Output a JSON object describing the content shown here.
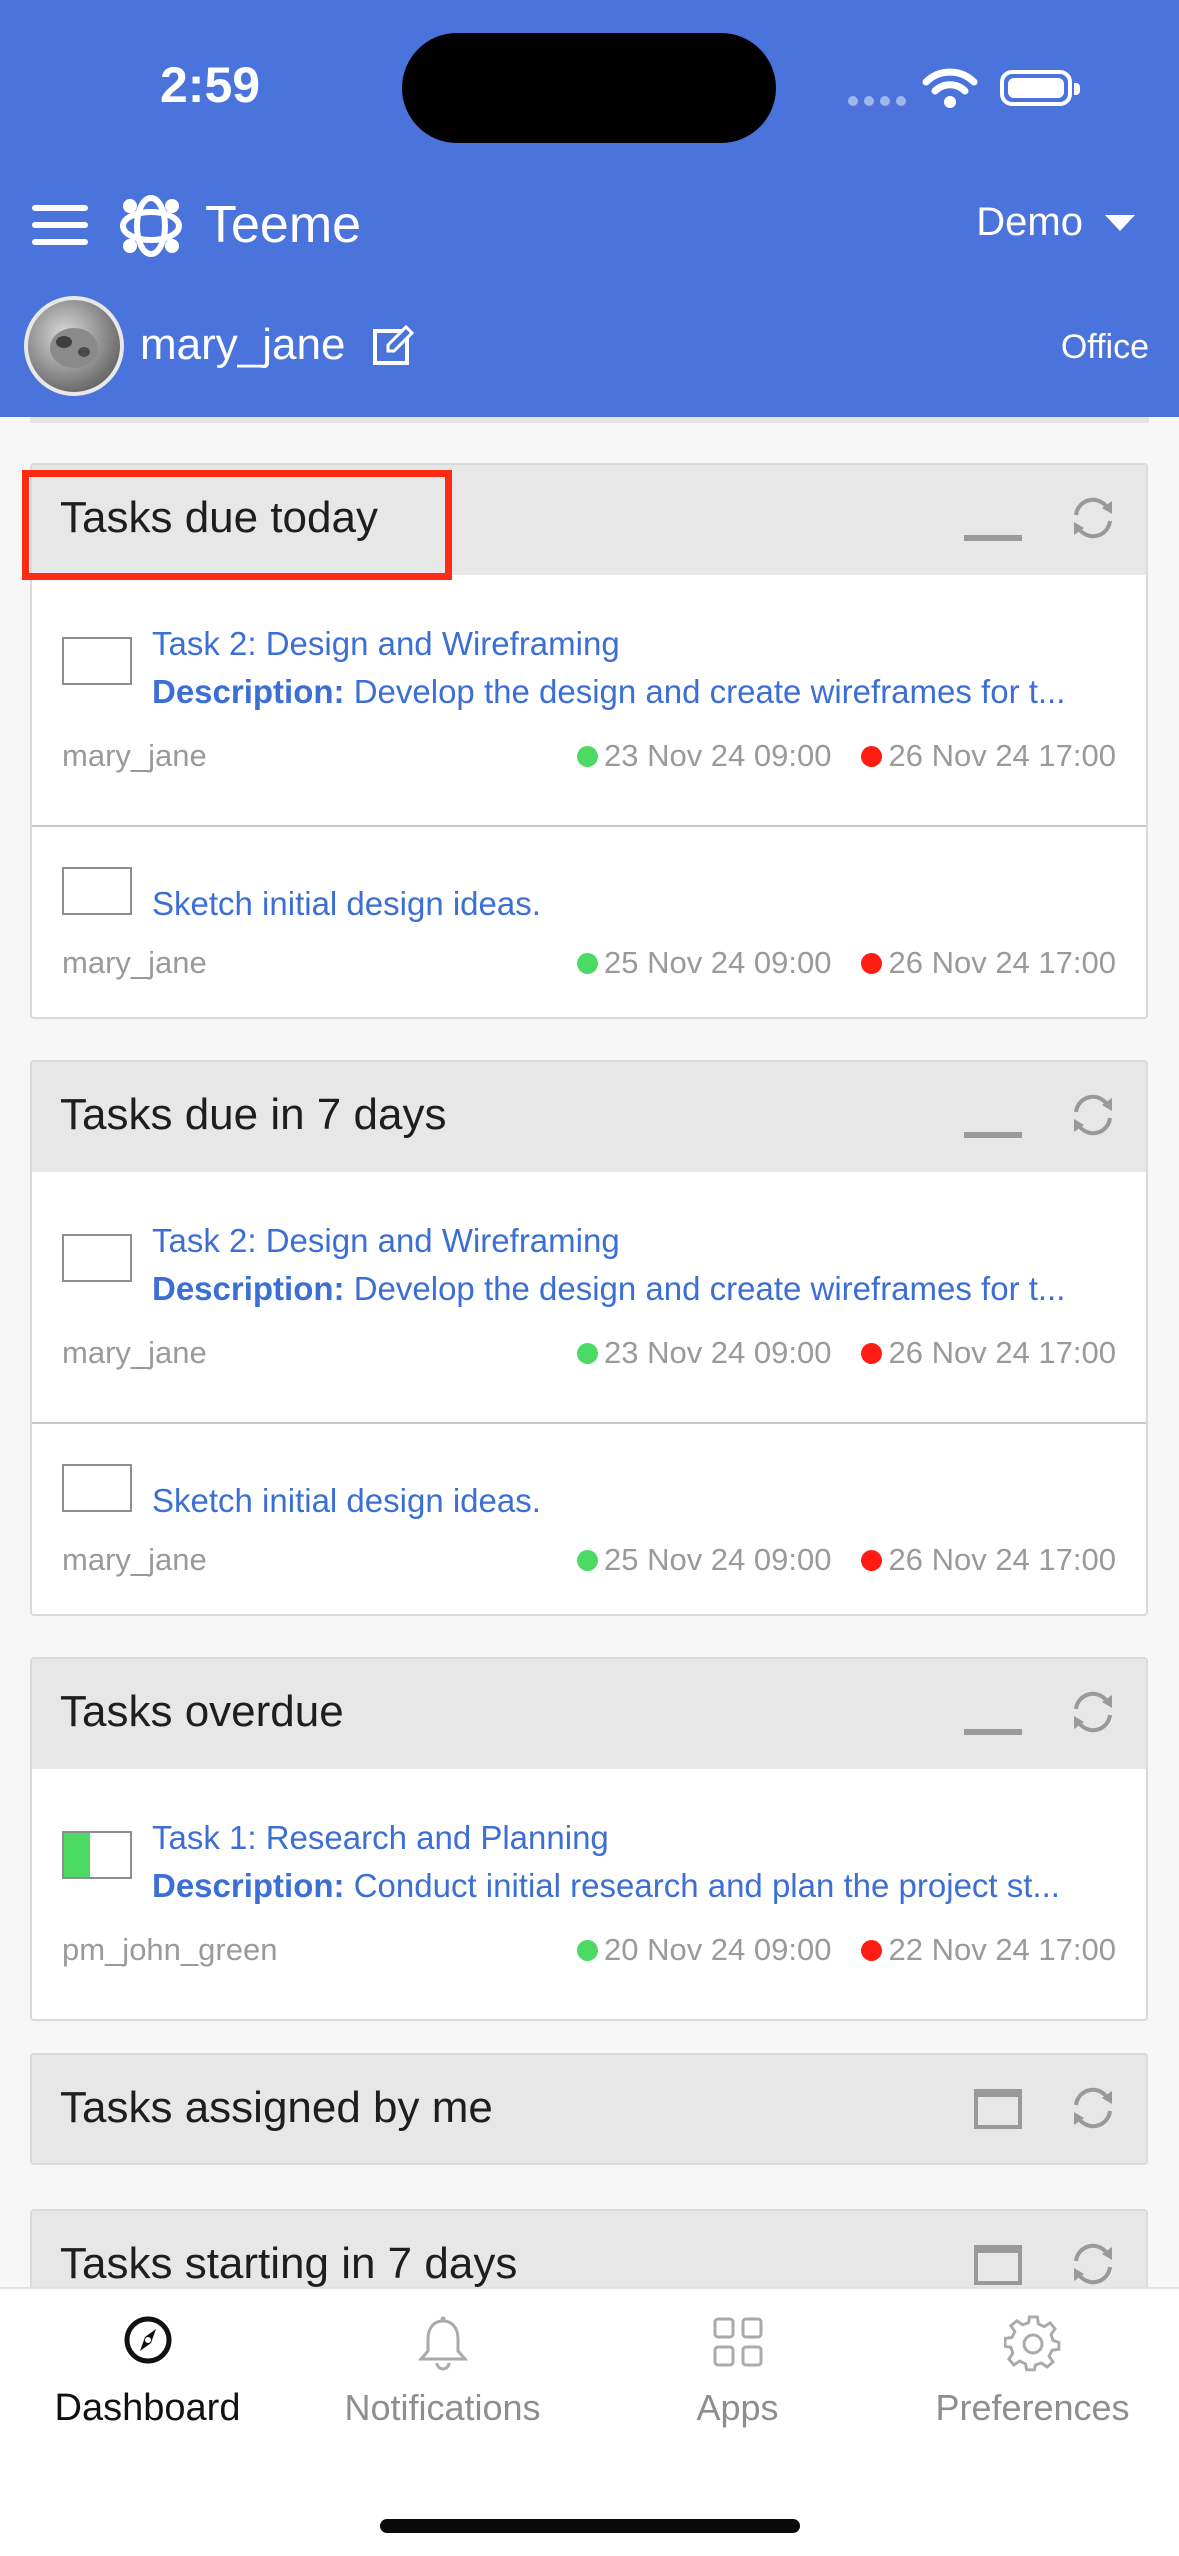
{
  "status_bar": {
    "time": "2:59"
  },
  "header": {
    "app_name": "Teeme",
    "workspace": "Demo",
    "username": "mary_jane",
    "location": "Office"
  },
  "panels": [
    {
      "title": "Tasks due today",
      "tasks": [
        {
          "title": "Task 2: Design and Wireframing",
          "description_label": "Description:",
          "description": "Develop the design and create wireframes for t...",
          "owner": "mary_jane",
          "start": "23 Nov 24 09:00",
          "end": "26 Nov 24 17:00"
        },
        {
          "title": "Sketch initial design ideas.",
          "owner": "mary_jane",
          "start": "25 Nov 24 09:00",
          "end": "26 Nov 24 17:00"
        }
      ]
    },
    {
      "title": "Tasks due in 7 days",
      "tasks": [
        {
          "title": "Task 2: Design and Wireframing",
          "description_label": "Description:",
          "description": "Develop the design and create wireframes for t...",
          "owner": "mary_jane",
          "start": "23 Nov 24 09:00",
          "end": "26 Nov 24 17:00"
        },
        {
          "title": "Sketch initial design ideas.",
          "owner": "mary_jane",
          "start": "25 Nov 24 09:00",
          "end": "26 Nov 24 17:00"
        }
      ]
    },
    {
      "title": "Tasks overdue",
      "tasks": [
        {
          "title": "Task 1: Research and Planning",
          "description_label": "Description:",
          "description": "Conduct initial research and plan the project st...",
          "owner": "pm_john_green",
          "start": "20 Nov 24 09:00",
          "end": "22 Nov 24 17:00",
          "progress": 0.4
        }
      ]
    },
    {
      "title": "Tasks assigned by me"
    },
    {
      "title": "Tasks starting in 7 days"
    }
  ],
  "tabs": [
    {
      "label": "Dashboard",
      "icon": "compass-icon",
      "active": true
    },
    {
      "label": "Notifications",
      "icon": "bell-icon"
    },
    {
      "label": "Apps",
      "icon": "grid-icon"
    },
    {
      "label": "Preferences",
      "icon": "gear-icon"
    }
  ],
  "colors": {
    "header": "#4a74dc",
    "link": "#3c6fd6",
    "start_dot": "#4cd964",
    "end_dot": "#ff1c12",
    "highlight": "#ff2a12"
  }
}
